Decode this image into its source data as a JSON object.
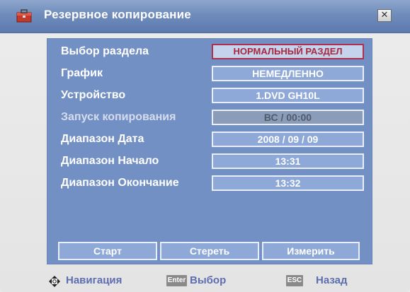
{
  "window": {
    "title": "Резервное копирование",
    "close_symbol": "✕"
  },
  "form": {
    "rows": [
      {
        "label": "Выбор раздела",
        "value": "НОРМАЛЬНЫЙ РАЗДЕЛ",
        "state": "selected"
      },
      {
        "label": "График",
        "value": "НЕМЕДЛЕННО",
        "state": "normal"
      },
      {
        "label": "Устройство",
        "value": "1.DVD GH10L",
        "state": "normal"
      },
      {
        "label": "Запуск копирования",
        "value": "ВС / 00:00",
        "state": "disabled"
      },
      {
        "label": "Диапазон Дата",
        "value": "2008 / 09 / 09",
        "state": "normal"
      },
      {
        "label": "Диапазон Начало",
        "value": "13:31",
        "state": "normal"
      },
      {
        "label": "Диапазон Окончание",
        "value": "13:32",
        "state": "normal"
      }
    ]
  },
  "buttons": {
    "start": "Старт",
    "erase": "Стереть",
    "measure": "Измерить"
  },
  "footer": {
    "nav_label": "Навигация",
    "enter_key": "Enter",
    "enter_label": "Выбор",
    "esc_key": "ESC",
    "esc_label": "Назад"
  },
  "colors": {
    "titlebar": "#6f8cbb",
    "panel": "#7390c4",
    "field": "#8ea8d8",
    "selected_border": "#b0304f",
    "footer_text": "#5d6eb0"
  },
  "icons": {
    "title": "toolbox-icon",
    "close": "close-icon",
    "nav": "navigation-arrows-icon"
  }
}
